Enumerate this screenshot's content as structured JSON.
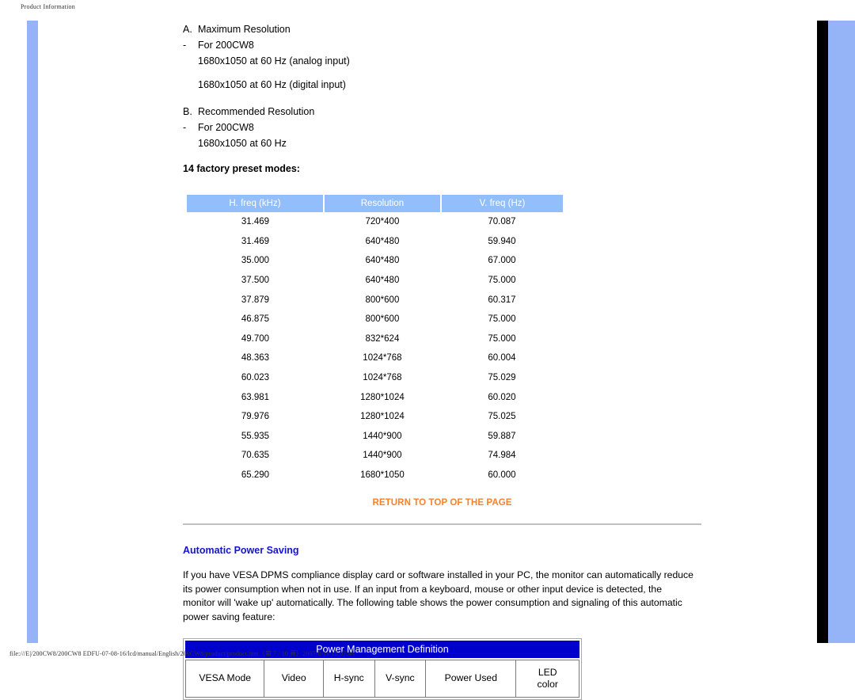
{
  "print": {
    "header": "Product Information",
    "footer": "file:///E|/200CW8/200CW8 EDFU-07-08-16/lcd/manual/English/200CW8/product/product.htm（第 7 / 10 頁）2007-8-16 15:07:46"
  },
  "colors": {
    "accent_blue": "#94b4f7",
    "table_header_blue": "#93befc",
    "pm_header_blue": "#0000cc",
    "link_orange": "#f9812a",
    "heading_blue": "#1414d2",
    "page_gray": "#eeeeee"
  },
  "resolution": {
    "lines": [
      {
        "marker": "A.",
        "text": "Maximum Resolution",
        "indented": false
      },
      {
        "marker": "-",
        "text": "For 200CW8",
        "indented": false
      },
      {
        "marker": "",
        "text": "1680x1050 at 60 Hz (analog input)",
        "indented": true
      }
    ],
    "lines2": [
      {
        "marker": "",
        "text": "1680x1050 at 60 Hz (digital input)",
        "indented": true
      }
    ],
    "lines3": [
      {
        "marker": "B.",
        "text": "Recommended Resolution",
        "indented": false
      },
      {
        "marker": "-",
        "text": "For 200CW8",
        "indented": false
      },
      {
        "marker": "",
        "text": "1680x1050 at 60 Hz",
        "indented": true
      }
    ],
    "preset_title": "14 factory preset modes:"
  },
  "modes_table": {
    "headers": [
      "H. freq (kHz)",
      "Resolution",
      "V. freq (Hz)"
    ],
    "rows": [
      [
        "31.469",
        "720*400",
        "70.087"
      ],
      [
        "31.469",
        "640*480",
        "59.940"
      ],
      [
        "35.000",
        "640*480",
        "67.000"
      ],
      [
        "37.500",
        "640*480",
        "75.000"
      ],
      [
        "37.879",
        "800*600",
        "60.317"
      ],
      [
        "46.875",
        "800*600",
        "75.000"
      ],
      [
        "49.700",
        "832*624",
        "75.000"
      ],
      [
        "48.363",
        "1024*768",
        "60.004"
      ],
      [
        "60.023",
        "1024*768",
        "75.029"
      ],
      [
        "63.981",
        "1280*1024",
        "60.020"
      ],
      [
        "79.976",
        "1280*1024",
        "75.025"
      ],
      [
        "55.935",
        "1440*900",
        "59.887"
      ],
      [
        "70.635",
        "1440*900",
        "74.984"
      ],
      [
        "65.290",
        "1680*1050",
        "60.000"
      ]
    ]
  },
  "return_link": "RETURN TO TOP OF THE PAGE",
  "power_saving": {
    "heading": "Automatic Power Saving",
    "paragraph": "If you have VESA DPMS compliance display card or software installed in your PC, the monitor can automatically reduce its power consumption when not in use. If an input from a keyboard, mouse or other input device is detected, the monitor will 'wake up' automatically. The following table shows the power consumption and signaling of this automatic power saving feature:",
    "table_title": "Power Management Definition",
    "columns": [
      "VESA Mode",
      "Video",
      "H-sync",
      "V-sync",
      "Power Used",
      "LED\ncolor"
    ]
  }
}
